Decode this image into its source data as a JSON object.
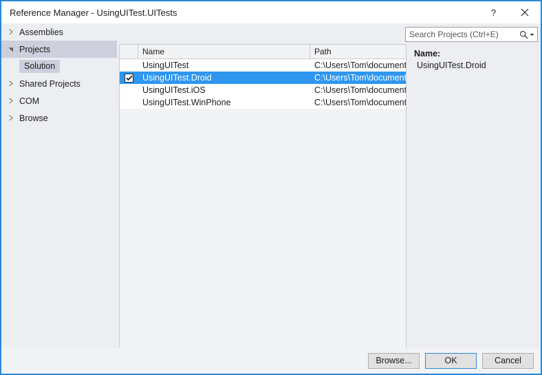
{
  "window": {
    "title": "Reference Manager - UsingUITest.UITests",
    "help_label": "?",
    "close_label": "✕",
    "accent_color": "#2a87d8"
  },
  "sidebar": {
    "items": [
      {
        "label": "Assemblies",
        "expanded": false,
        "selected": false
      },
      {
        "label": "Projects",
        "expanded": true,
        "selected": true
      },
      {
        "label": "Shared Projects",
        "expanded": false,
        "selected": false
      },
      {
        "label": "COM",
        "expanded": false,
        "selected": false
      },
      {
        "label": "Browse",
        "expanded": false,
        "selected": false
      }
    ],
    "projects_child": "Solution"
  },
  "search": {
    "placeholder": "Search Projects (Ctrl+E)",
    "value": ""
  },
  "list": {
    "columns": {
      "check": "",
      "name": "Name",
      "path": "Path"
    },
    "rows": [
      {
        "checked": false,
        "name": "UsingUITest",
        "path": "C:\\Users\\Tom\\document",
        "selected": false
      },
      {
        "checked": true,
        "name": "UsingUITest.Droid",
        "path": "C:\\Users\\Tom\\document",
        "selected": true
      },
      {
        "checked": false,
        "name": "UsingUITest.iOS",
        "path": "C:\\Users\\Tom\\document",
        "selected": false
      },
      {
        "checked": false,
        "name": "UsingUITest.WinPhone",
        "path": "C:\\Users\\Tom\\document",
        "selected": false
      }
    ],
    "selection_color": "#2f96ef"
  },
  "details": {
    "name_label": "Name:",
    "name_value": "UsingUITest.Droid"
  },
  "footer": {
    "browse_label": "Browse...",
    "ok_label": "OK",
    "cancel_label": "Cancel"
  }
}
